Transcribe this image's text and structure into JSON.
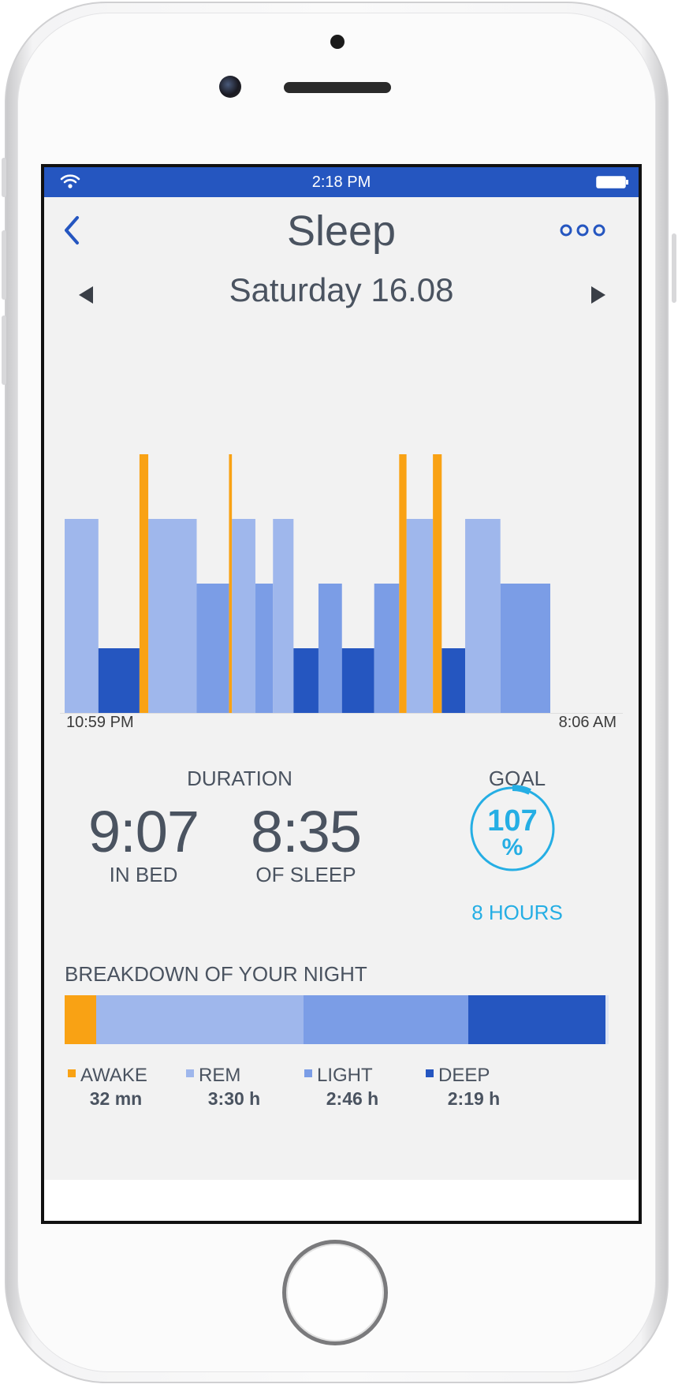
{
  "status_bar": {
    "time": "2:18 PM",
    "color": "#2556c0",
    "wifi_icon": "wifi-icon",
    "battery_icon": "battery-icon"
  },
  "header": {
    "title": "Sleep",
    "back_icon": "chevron-left-icon",
    "more_icon": "more-icon",
    "accent": "#2556c0"
  },
  "date_nav": {
    "date": "Saturday 16.08",
    "prev_icon": "triangle-left-icon",
    "next_icon": "triangle-right-icon"
  },
  "chart_data": {
    "type": "bar",
    "title": "",
    "xlabel": "",
    "ylabel": "",
    "x_start_label": "10:59 PM",
    "x_end_label": "8:06 AM",
    "y_levels": [
      "deep",
      "light",
      "rem",
      "awake"
    ],
    "colors": {
      "awake": "#f9a214",
      "rem": "#9fb7ec",
      "light": "#7b9de6",
      "deep": "#2556c0"
    },
    "segments": [
      {
        "stage": "rem",
        "start_min": 0,
        "end_min": 23
      },
      {
        "stage": "deep",
        "start_min": 23,
        "end_min": 51
      },
      {
        "stage": "awake",
        "start_min": 51,
        "end_min": 57
      },
      {
        "stage": "rem",
        "start_min": 57,
        "end_min": 90
      },
      {
        "stage": "light",
        "start_min": 90,
        "end_min": 112
      },
      {
        "stage": "awake",
        "start_min": 112,
        "end_min": 114
      },
      {
        "stage": "rem",
        "start_min": 114,
        "end_min": 130
      },
      {
        "stage": "light",
        "start_min": 130,
        "end_min": 142
      },
      {
        "stage": "rem",
        "start_min": 142,
        "end_min": 156
      },
      {
        "stage": "deep",
        "start_min": 156,
        "end_min": 173
      },
      {
        "stage": "light",
        "start_min": 173,
        "end_min": 189
      },
      {
        "stage": "deep",
        "start_min": 189,
        "end_min": 211
      },
      {
        "stage": "light",
        "start_min": 211,
        "end_min": 228
      },
      {
        "stage": "awake",
        "start_min": 228,
        "end_min": 233
      },
      {
        "stage": "rem",
        "start_min": 233,
        "end_min": 251
      },
      {
        "stage": "awake",
        "start_min": 251,
        "end_min": 257
      },
      {
        "stage": "deep",
        "start_min": 257,
        "end_min": 273
      },
      {
        "stage": "rem",
        "start_min": 273,
        "end_min": 297
      },
      {
        "stage": "light",
        "start_min": 297,
        "end_min": 331
      }
    ]
  },
  "duration": {
    "heading": "DURATION",
    "in_bed_value": "9:07",
    "in_bed_label": "IN BED",
    "sleep_value": "8:35",
    "sleep_label": "OF SLEEP"
  },
  "goal": {
    "heading": "GOAL",
    "percent_value": "107",
    "percent_sign": "%",
    "target": "8 HOURS",
    "progress": 1.07,
    "color": "#25aee4"
  },
  "breakdown": {
    "heading": "BREAKDOWN OF YOUR NIGHT",
    "items": [
      {
        "label": "AWAKE",
        "value": "32 mn",
        "minutes": 32,
        "color": "#f9a214"
      },
      {
        "label": "REM",
        "value": "3:30 h",
        "minutes": 210,
        "color": "#9fb7ec"
      },
      {
        "label": "LIGHT",
        "value": "2:46 h",
        "minutes": 166,
        "color": "#7b9de6"
      },
      {
        "label": "DEEP",
        "value": "2:19 h",
        "minutes": 139,
        "color": "#2556c0"
      }
    ]
  }
}
